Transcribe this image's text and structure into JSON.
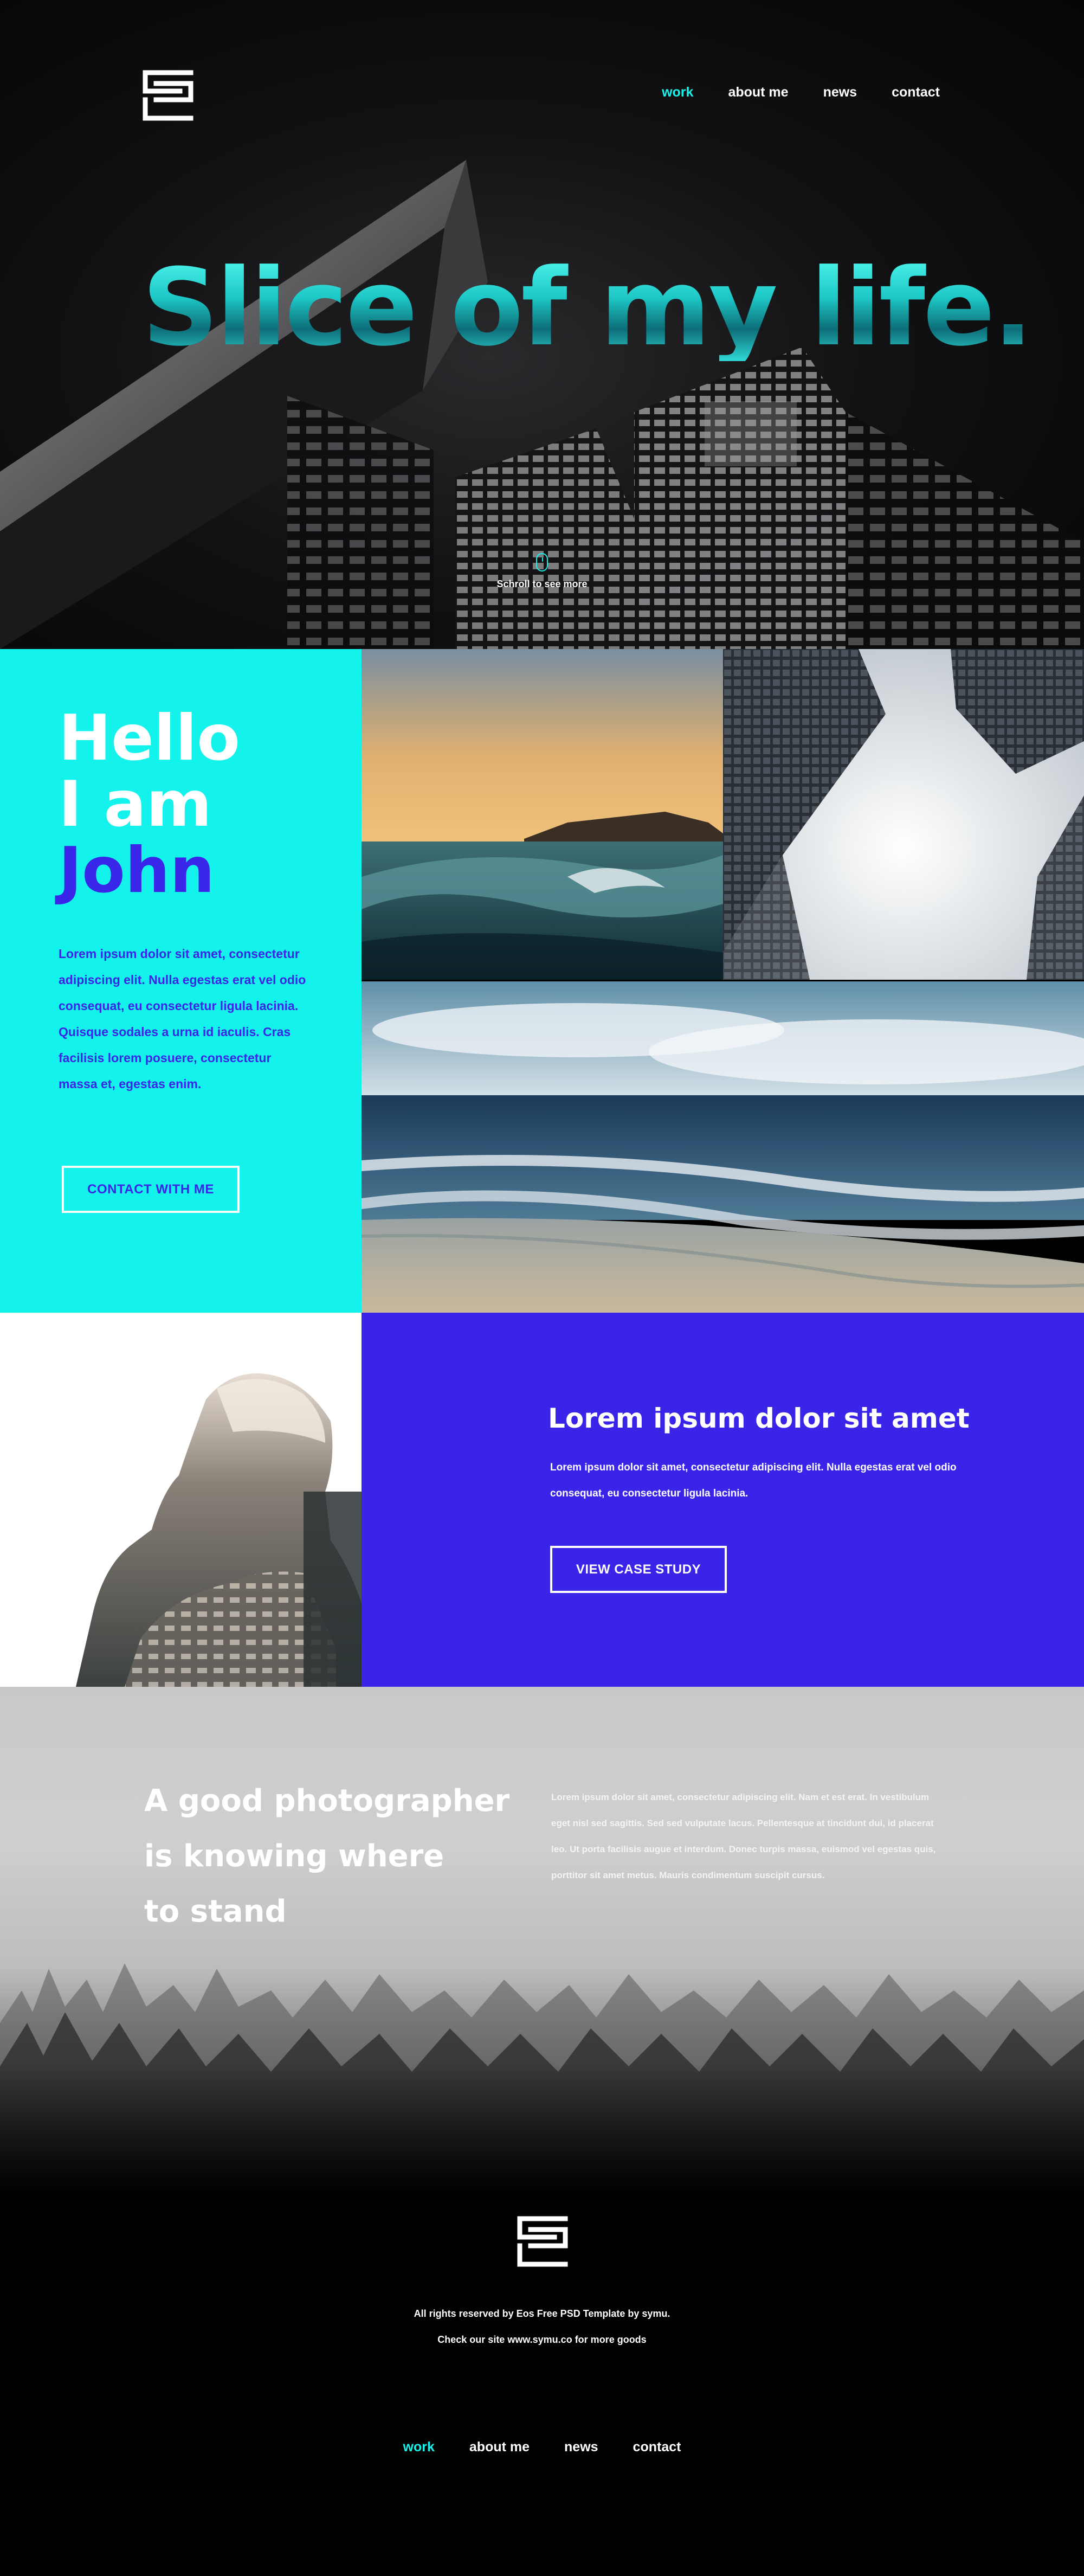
{
  "header": {
    "logo": "eos-logo",
    "nav": [
      {
        "label": "work",
        "active": true
      },
      {
        "label": "about me",
        "active": false
      },
      {
        "label": "news",
        "active": false
      },
      {
        "label": "contact",
        "active": false
      }
    ]
  },
  "hero": {
    "title": "Slice of my life.",
    "scroll_icon": "mouse-icon",
    "scroll_text": "Schroll to see more"
  },
  "about": {
    "greeting_line1": "Hello",
    "greeting_line2": "I am",
    "name": "John",
    "text": "Lorem ipsum dolor sit amet, consectetur adipiscing elit. Nulla egestas erat vel odio consequat, eu consectetur ligula lacinia. Quisque sodales a urna id iaculis. Cras facilisis lorem posuere, consectetur massa et, egestas enim.",
    "button": "CONTACT WITH ME"
  },
  "case_study": {
    "title": "Lorem ipsum dolor sit amet",
    "text": "Lorem ipsum dolor sit amet, consectetur adipiscing elit. Nulla egestas erat vel odio consequat, eu consectetur ligula lacinia.",
    "button": "VIEW CASE STUDY"
  },
  "quote": {
    "line1": "A good photographer",
    "line2": "is knowing where",
    "line3": "to stand",
    "text": "Lorem ipsum dolor sit amet, consectetur adipiscing elit. Nam et est erat. In vestibulum eget nisl sed sagittis. Sed sed vulputate lacus. Pellentesque at tincidunt dui, id placerat leo. Ut porta facilisis augue et interdum. Donec turpis massa, euismod vel egestas quis, porttitor sit amet metus. Mauris condimentum suscipit cursus."
  },
  "footer": {
    "logo": "eos-logo",
    "rights": "All rights reserved by Eos Free PSD Template by symu.",
    "site": "Check our site www.symu.co for more goods",
    "nav": [
      {
        "label": "work",
        "active": true
      },
      {
        "label": "about me",
        "active": false
      },
      {
        "label": "news",
        "active": false
      },
      {
        "label": "contact",
        "active": false
      }
    ]
  },
  "colors": {
    "accent_cyan": "#19f0ea",
    "accent_blue": "#3a24e8",
    "background": "#000000"
  }
}
